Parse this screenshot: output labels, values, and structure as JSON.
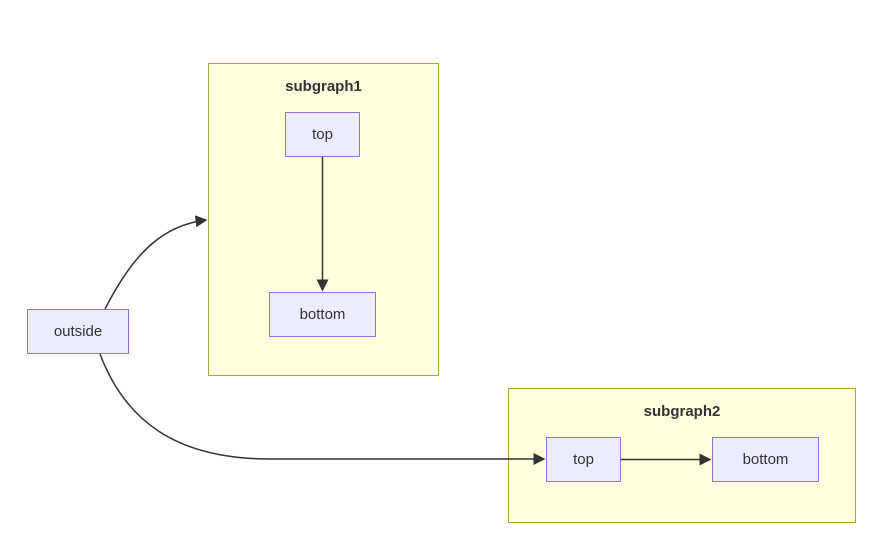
{
  "nodes": {
    "outside": {
      "label": "outside"
    },
    "sg1": {
      "title": "subgraph1",
      "top": {
        "label": "top"
      },
      "bottom": {
        "label": "bottom"
      }
    },
    "sg2": {
      "title": "subgraph2",
      "top": {
        "label": "top"
      },
      "bottom": {
        "label": "bottom"
      }
    }
  },
  "colors": {
    "nodeFill": "#ececff",
    "nodeStroke": "#9370db",
    "subgraphFill": "#ffffde",
    "subgraphStroke": "#a9a93b",
    "edge": "#333333"
  },
  "chart_data": {
    "type": "flowchart",
    "nodes": [
      {
        "id": "outside",
        "label": "outside"
      },
      {
        "id": "subgraph1",
        "label": "subgraph1",
        "container": true,
        "children": [
          "top1",
          "bottom1"
        ]
      },
      {
        "id": "top1",
        "label": "top",
        "parent": "subgraph1"
      },
      {
        "id": "bottom1",
        "label": "bottom",
        "parent": "subgraph1"
      },
      {
        "id": "subgraph2",
        "label": "subgraph2",
        "container": true,
        "children": [
          "top2",
          "bottom2"
        ]
      },
      {
        "id": "top2",
        "label": "top",
        "parent": "subgraph2"
      },
      {
        "id": "bottom2",
        "label": "bottom",
        "parent": "subgraph2"
      }
    ],
    "edges": [
      {
        "from": "outside",
        "to": "subgraph1"
      },
      {
        "from": "outside",
        "to": "top2"
      },
      {
        "from": "top1",
        "to": "bottom1"
      },
      {
        "from": "top2",
        "to": "bottom2"
      }
    ]
  }
}
